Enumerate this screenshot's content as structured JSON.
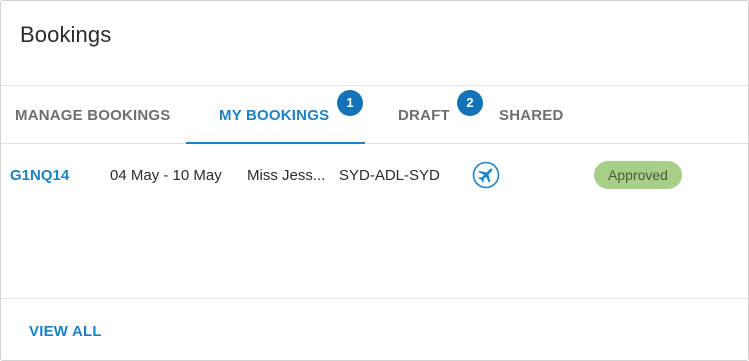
{
  "card": {
    "title": "Bookings"
  },
  "tabs": [
    {
      "label": "MANAGE BOOKINGS",
      "active": false,
      "badge": null
    },
    {
      "label": "MY BOOKINGS",
      "active": true,
      "badge": "1"
    },
    {
      "label": "DRAFT",
      "active": false,
      "badge": "2"
    },
    {
      "label": "SHARED",
      "active": false,
      "badge": null
    }
  ],
  "bookings": [
    {
      "reference": "G1NQ14",
      "dates": "04 May - 10 May",
      "traveller": "Miss Jess...",
      "route": "SYD-ADL-SYD",
      "type_icon": "airplane-icon",
      "status": "Approved"
    }
  ],
  "footer": {
    "view_all_label": "VIEW ALL"
  },
  "colors": {
    "accent": "#1a83c6",
    "badge": "#1473b8",
    "status_approved": "#a8cf88",
    "tab_inactive": "#6f6f6f"
  }
}
